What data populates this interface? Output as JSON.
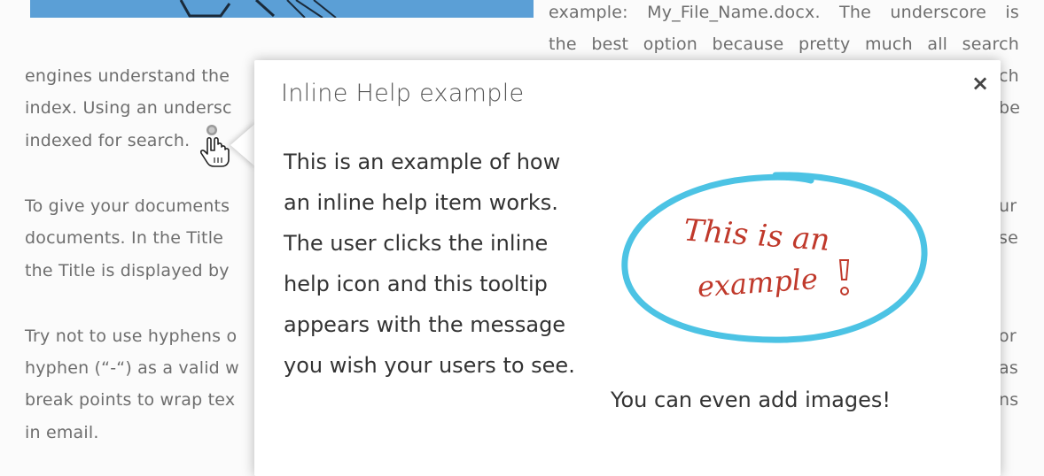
{
  "background": {
    "right_column_lines": [
      "example: My_File_Name.docx. The underscore is",
      "the best option because pretty much all search"
    ],
    "left_column_lines": [
      "engines understand the",
      "index. Using an undersc",
      "indexed for search.",
      "To give your documents",
      "documents. In the Title",
      "the Title is displayed by",
      "Try not to use hyphens o",
      "hyphen (“-“) as a valid w",
      "break points to wrap tex",
      "in email."
    ],
    "edge_fragments": [
      "ch",
      "be",
      "ur",
      "se",
      "or",
      "as",
      "ns"
    ]
  },
  "popover": {
    "title": "Inline Help example",
    "close_glyph": "×",
    "body_lines": [
      "This is an example of how",
      "an inline help item works.",
      "The user clicks the inline",
      "help icon and this tooltip",
      "appears with the message",
      "you wish your users to see."
    ],
    "handwritten_line1": "This is an",
    "handwritten_line2": "example",
    "caption": "You can even add images!"
  },
  "colors": {
    "circle": "#4cc3e4",
    "handwriting": "#c0392b",
    "hero": "#5b9fd6"
  },
  "icons": [
    "help-dot-icon",
    "hand-cursor-icon",
    "close-icon"
  ]
}
